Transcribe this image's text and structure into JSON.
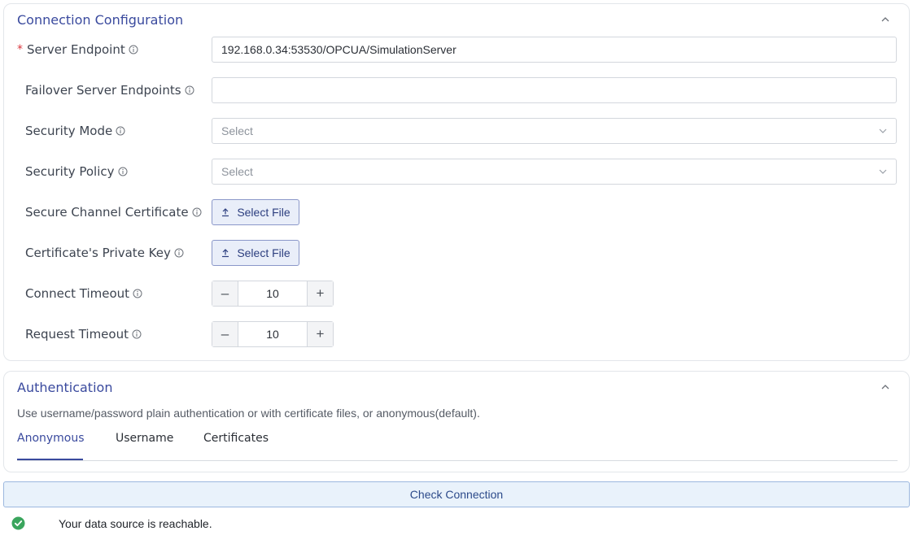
{
  "connection": {
    "title": "Connection Configuration",
    "fields": {
      "server_endpoint": {
        "label": "Server Endpoint",
        "required_mark": "*",
        "value": "192.168.0.34:53530/OPCUA/SimulationServer"
      },
      "failover_endpoints": {
        "label": "Failover Server Endpoints",
        "value": ""
      },
      "security_mode": {
        "label": "Security Mode",
        "placeholder": "Select"
      },
      "security_policy": {
        "label": "Security Policy",
        "placeholder": "Select"
      },
      "secure_channel_cert": {
        "label": "Secure Channel Certificate",
        "button": "Select File"
      },
      "private_key": {
        "label": "Certificate's Private Key",
        "button": "Select File"
      },
      "connect_timeout": {
        "label": "Connect Timeout",
        "value": "10"
      },
      "request_timeout": {
        "label": "Request Timeout",
        "value": "10"
      }
    },
    "stepper": {
      "minus": "–",
      "plus": "+"
    }
  },
  "authentication": {
    "title": "Authentication",
    "description": "Use username/password plain authentication or with certificate files, or anonymous(default).",
    "tabs": [
      "Anonymous",
      "Username",
      "Certificates"
    ],
    "active_tab": "Anonymous"
  },
  "actions": {
    "check_connection": "Check Connection"
  },
  "status": {
    "message": "Your data source is reachable.",
    "color": "#3aa55d"
  },
  "colors": {
    "accent": "#3a4a9e",
    "required": "#d9363e"
  }
}
